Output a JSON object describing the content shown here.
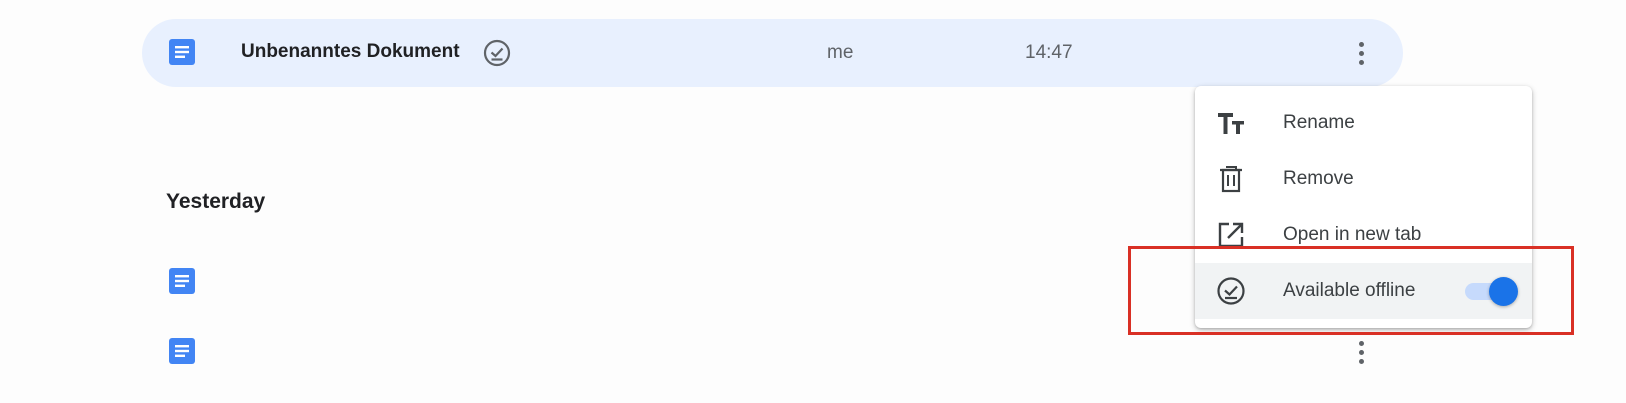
{
  "files": {
    "selected_row": {
      "title": "Unbenanntes Dokument",
      "owner": "me",
      "modified": "14:47",
      "icon": "google-docs-icon",
      "offline_icon": "offline-check-icon"
    },
    "sections": [
      {
        "title": "Yesterday"
      }
    ]
  },
  "context_menu": {
    "items": [
      {
        "label": "Rename",
        "icon": "text-format-icon"
      },
      {
        "label": "Remove",
        "icon": "trash-icon"
      },
      {
        "label": "Open in new tab",
        "icon": "open-in-new-icon"
      },
      {
        "label": "Available offline",
        "icon": "offline-check-icon",
        "toggle_on": true
      }
    ]
  },
  "colors": {
    "selected_row_bg": "#e8f0fe",
    "docs_blue": "#4285f4",
    "toggle_blue": "#1a73e8",
    "highlight_red": "#d93025"
  }
}
